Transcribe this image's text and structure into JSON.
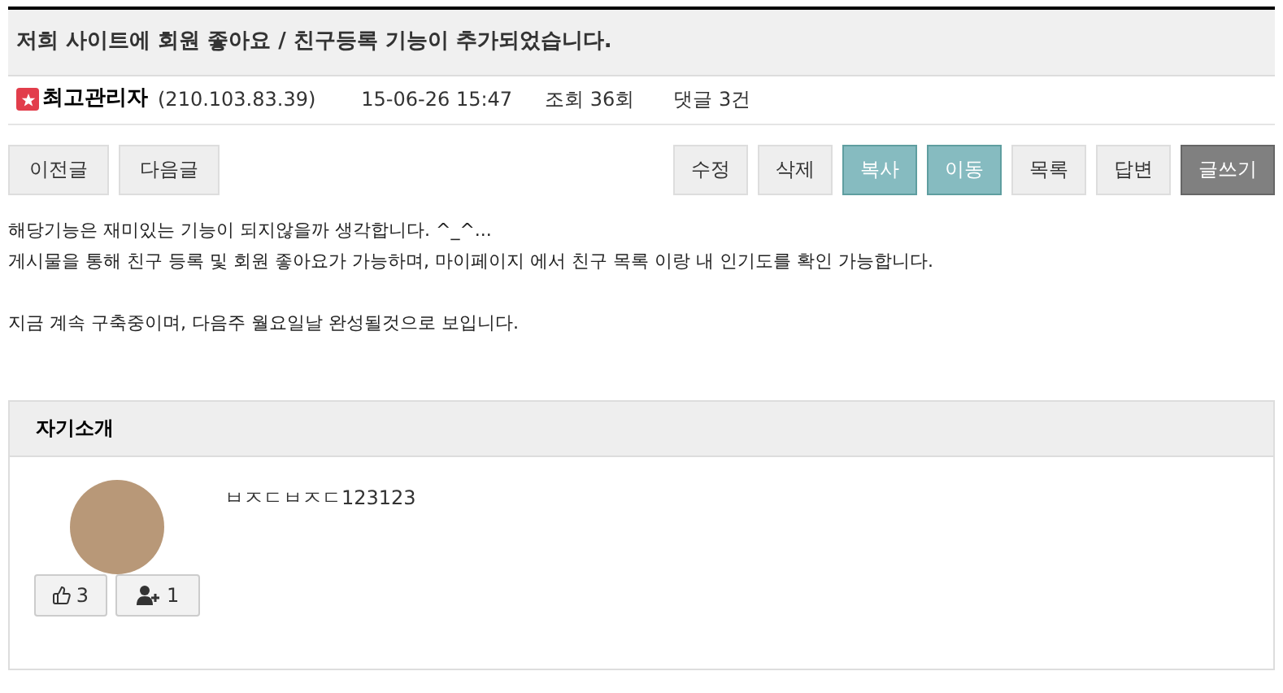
{
  "post": {
    "title": "저희 사이트에 회원 좋아요 / 친구등록 기능이 추가되었습니다.",
    "author": "최고관리자",
    "ip": "(210.103.83.39)",
    "date": "15-06-26 15:47",
    "views": "조회 36회",
    "comments": "댓글 3건"
  },
  "nav_buttons": [
    "이전글",
    "다음글"
  ],
  "action_buttons": [
    {
      "label": "수정",
      "kind": "default"
    },
    {
      "label": "삭제",
      "kind": "default"
    },
    {
      "label": "복사",
      "kind": "admin"
    },
    {
      "label": "이동",
      "kind": "admin"
    },
    {
      "label": "목록",
      "kind": "default"
    },
    {
      "label": "답변",
      "kind": "default"
    },
    {
      "label": "글쓰기",
      "kind": "primary"
    }
  ],
  "body": [
    [
      "해당기능은 재미있는 기능이 되지않을까 생각합니다. ^_^...",
      "게시물을 통해 친구 등록 및 회원 좋아요가 가능하며, 마이페이지 에서 친구 목록 이랑 내 인기도를 확인 가능합니다."
    ],
    [
      "지금 계속 구축중이며, 다음주 월요일날 완성될것으로 보입니다."
    ]
  ],
  "profile": {
    "heading": "자기소개",
    "likes": "3",
    "friends": "1",
    "intro": "ㅂㅈㄷㅂㅈㄷ123123"
  }
}
